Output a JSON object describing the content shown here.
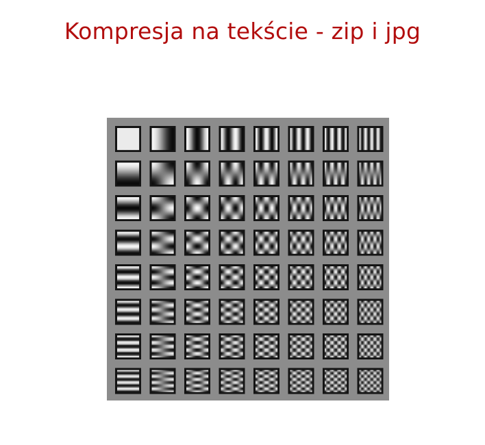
{
  "slide": {
    "title": "Kompresja na tekście - zip i jpg"
  },
  "figure": {
    "grid_rows": 8,
    "grid_cols": 8
  },
  "colors": {
    "title": "#b20d0d",
    "figure_background": "#8c8c8c",
    "tile_frame": "#141414"
  }
}
